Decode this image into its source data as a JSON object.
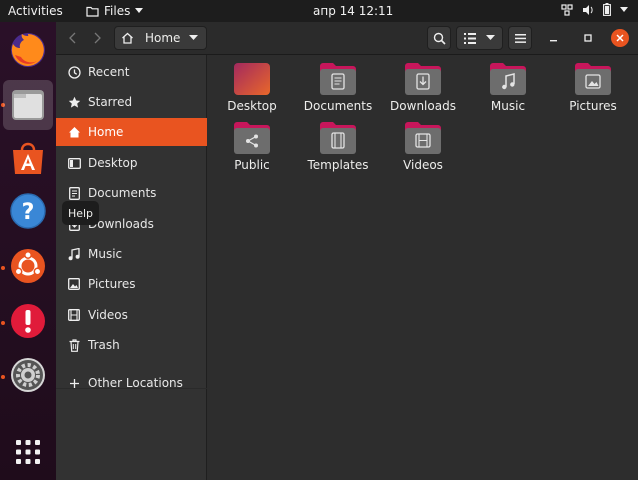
{
  "topbar": {
    "activities": "Activities",
    "app_menu": "Files",
    "clock": "апр 14  12:11"
  },
  "dock": {
    "tooltip": "Help",
    "items": [
      {
        "name": "Firefox",
        "icon": "firefox-icon",
        "running": true
      },
      {
        "name": "Files",
        "icon": "files-icon",
        "running": true,
        "active": true
      },
      {
        "name": "Ubuntu Software",
        "icon": "software-icon",
        "running": false
      },
      {
        "name": "Help",
        "icon": "help-icon",
        "running": false,
        "hovered": true
      },
      {
        "name": "Ubuntu",
        "icon": "ubuntu-icon",
        "running": true
      },
      {
        "name": "Error Reporter",
        "icon": "error-icon",
        "running": true
      },
      {
        "name": "Settings",
        "icon": "settings-icon",
        "running": true
      },
      {
        "name": "Show Applications",
        "icon": "app-grid-icon",
        "running": false
      }
    ]
  },
  "header": {
    "path": "Home"
  },
  "sidebar": {
    "items": [
      {
        "label": "Recent",
        "icon": "clock-icon"
      },
      {
        "label": "Starred",
        "icon": "star-icon"
      },
      {
        "label": "Home",
        "icon": "home-icon",
        "selected": true
      },
      {
        "label": "Desktop",
        "icon": "desktop-icon"
      },
      {
        "label": "Documents",
        "icon": "documents-icon"
      },
      {
        "label": "Downloads",
        "icon": "downloads-icon"
      },
      {
        "label": "Music",
        "icon": "music-icon"
      },
      {
        "label": "Pictures",
        "icon": "pictures-icon"
      },
      {
        "label": "Videos",
        "icon": "videos-icon"
      },
      {
        "label": "Trash",
        "icon": "trash-icon"
      }
    ],
    "other_locations": "Other Locations"
  },
  "files": [
    {
      "name": "Desktop",
      "icon": "desktop-folder-icon"
    },
    {
      "name": "Documents",
      "icon": "documents-folder-icon"
    },
    {
      "name": "Downloads",
      "icon": "downloads-folder-icon"
    },
    {
      "name": "Music",
      "icon": "music-folder-icon"
    },
    {
      "name": "Pictures",
      "icon": "pictures-folder-icon"
    },
    {
      "name": "Public",
      "icon": "public-folder-icon"
    },
    {
      "name": "Templates",
      "icon": "templates-folder-icon"
    },
    {
      "name": "Videos",
      "icon": "videos-folder-icon"
    }
  ],
  "colors": {
    "accent": "#e95420",
    "folder_tab": "#c7165b",
    "folder_body": "#6d6d6d"
  }
}
